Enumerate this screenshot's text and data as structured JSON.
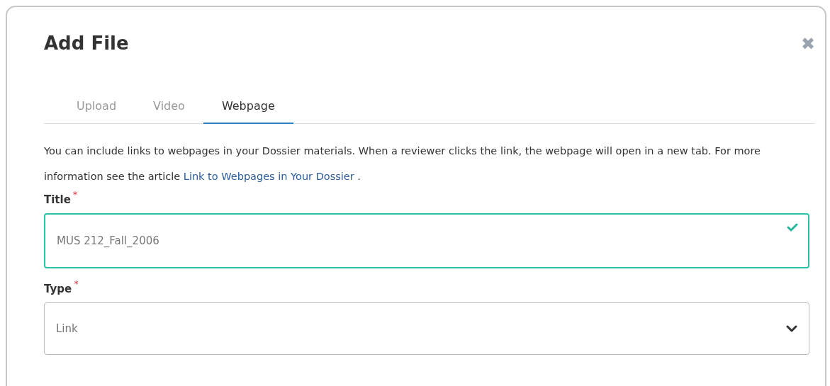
{
  "dialog": {
    "title": "Add File",
    "close_icon": "✖"
  },
  "tabs": [
    {
      "label": "Upload",
      "selected": false
    },
    {
      "label": "Video",
      "selected": false
    },
    {
      "label": "Webpage",
      "selected": true
    }
  ],
  "description": {
    "text": "You can include links to webpages in your Dossier materials. When a reviewer clicks the link, the webpage will open in a new tab. For more information see the article ",
    "link": "Link to Webpages in Your Dossier",
    "after": " ."
  },
  "fields": [
    {
      "kind": "text",
      "label": "Title",
      "required_mark": "*",
      "value": "MUS 212_Fall_2006",
      "valid": true
    },
    {
      "kind": "select",
      "label": "Type",
      "required_mark": "*",
      "value": "Link"
    }
  ]
}
